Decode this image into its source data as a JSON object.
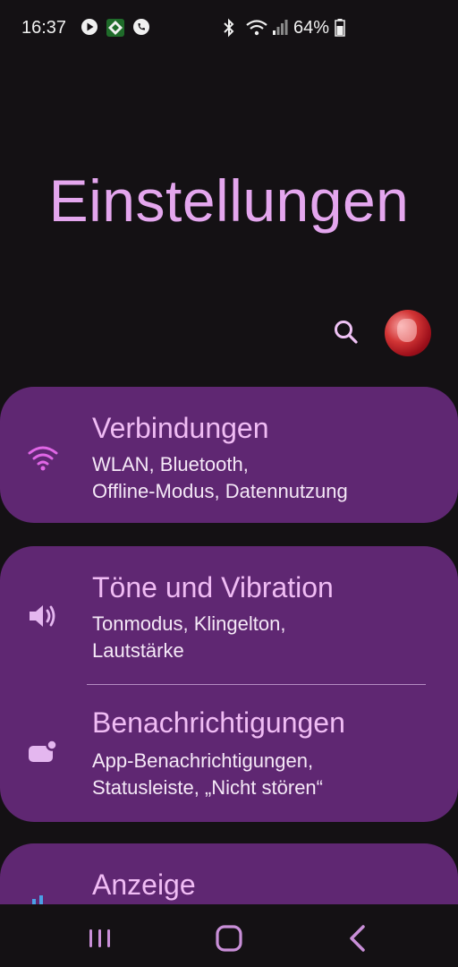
{
  "status_bar": {
    "time": "16:37",
    "battery_percent": "64%",
    "icons_left": [
      "play-icon",
      "app-icon",
      "whatsapp-call-icon"
    ],
    "icons_right": [
      "bluetooth-icon",
      "wifi-icon",
      "signal-icon",
      "battery-icon"
    ]
  },
  "page": {
    "title": "Einstellungen"
  },
  "header_actions": {
    "search_icon": "search-icon",
    "avatar": "avatar"
  },
  "settings": [
    {
      "title": "Verbindungen",
      "subtitle_lines": [
        "WLAN, Bluetooth,",
        "Offline-Modus, Datennutzung"
      ],
      "icon": "wifi-icon",
      "icon_color": "#e066e6"
    },
    {
      "title": "Töne und Vibration",
      "subtitle_lines": [
        "Tonmodus, Klingelton,",
        "Lautstärke"
      ],
      "icon": "speaker-icon",
      "icon_color": "#e4b7ef"
    },
    {
      "title": "Benachrichtigungen",
      "subtitle_lines": [
        "App-Benachrichtigungen,",
        "Statusleiste, „Nicht stören“"
      ],
      "icon": "notification-icon",
      "icon_color": "#e4b7ef"
    },
    {
      "title": "Anzeige",
      "subtitle_lines": [],
      "icon": "display-icon",
      "icon_color": "#4aa0e6"
    }
  ],
  "nav_bar": {
    "buttons": [
      "recents-icon",
      "home-icon",
      "back-icon"
    ],
    "color": "#c98fd8"
  },
  "colors": {
    "background": "#141114",
    "card": "#5f2772",
    "title": "#e4a6ee",
    "item_title": "#f0bcf4"
  }
}
